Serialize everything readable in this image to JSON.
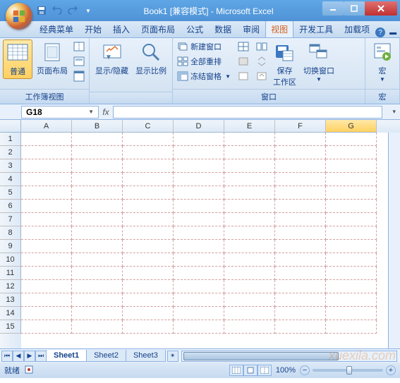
{
  "title": {
    "doc": "Book1",
    "mode": "[兼容模式]",
    "app": "Microsoft Excel"
  },
  "tabs": {
    "items": [
      "经典菜单",
      "开始",
      "插入",
      "页面布局",
      "公式",
      "数据",
      "审阅",
      "视图",
      "开发工具",
      "加载项"
    ],
    "active": "视图"
  },
  "ribbon": {
    "group1": {
      "label": "工作簿视图",
      "normal": "普通",
      "page_layout": "页面布局"
    },
    "group2": {
      "show_hide": "显示/隐藏",
      "zoom": "显示比例"
    },
    "group3": {
      "label": "窗口",
      "new_window": "新建窗口",
      "arrange_all": "全部重排",
      "freeze": "冻结窗格",
      "save_ws": "保存\n工作区",
      "switch": "切换窗口"
    },
    "group4": {
      "label": "宏",
      "macro": "宏"
    }
  },
  "formula": {
    "namebox": "G18",
    "fx": "fx"
  },
  "columns": [
    "A",
    "B",
    "C",
    "D",
    "E",
    "F",
    "G"
  ],
  "rows": [
    "1",
    "2",
    "3",
    "4",
    "5",
    "6",
    "7",
    "8",
    "9",
    "10",
    "11",
    "12",
    "13",
    "14",
    "15"
  ],
  "selected_col": "G",
  "sheets": {
    "items": [
      "Sheet1",
      "Sheet2",
      "Sheet3"
    ],
    "active": "Sheet1"
  },
  "status": {
    "ready": "就绪",
    "zoom": "100%"
  },
  "watermark": "xuexila.com"
}
